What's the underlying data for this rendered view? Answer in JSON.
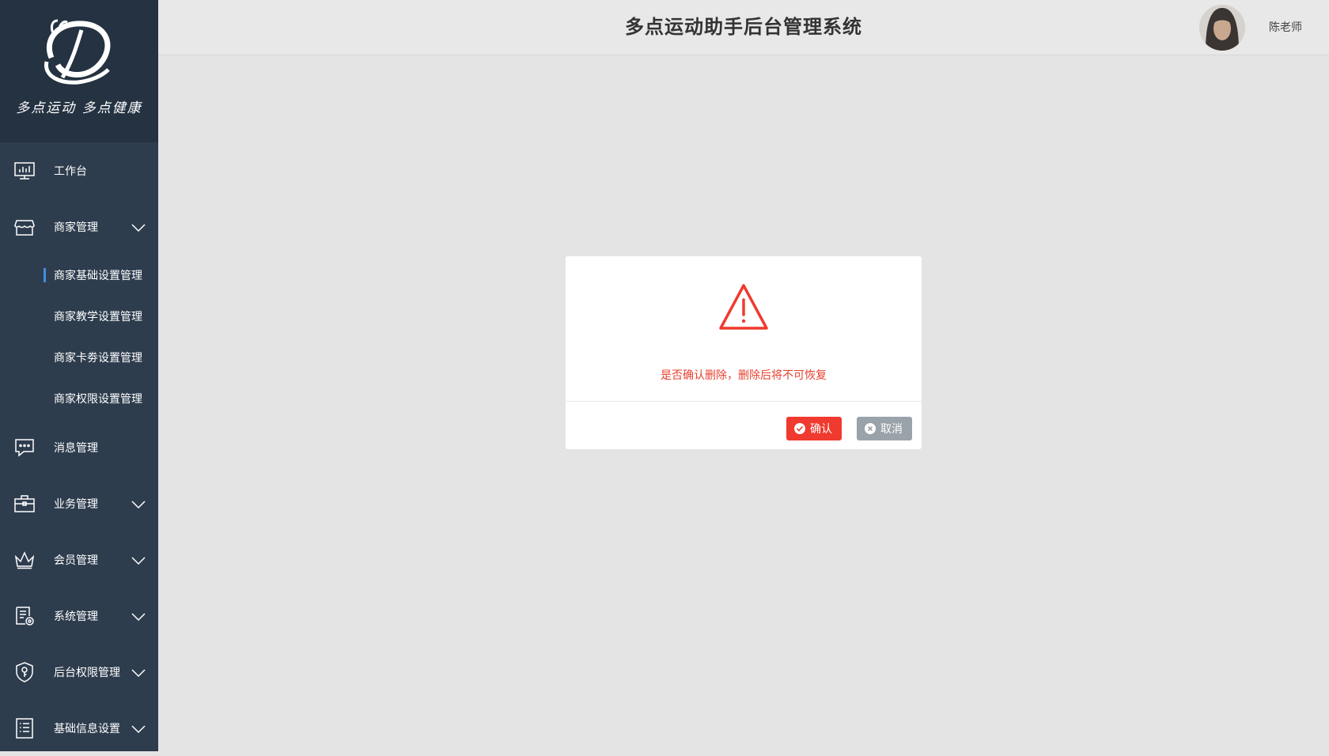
{
  "brand": {
    "slogan": "多点运动 多点健康"
  },
  "header": {
    "title": "多点运动助手后台管理系统",
    "username": "陈老师"
  },
  "sidebar": {
    "items": [
      {
        "label": "工作台",
        "icon": "monitor-chart-icon",
        "expandable": false
      },
      {
        "label": "商家管理",
        "icon": "store-icon",
        "expandable": true,
        "expanded": true,
        "children": [
          {
            "label": "商家基础设置管理",
            "active": true
          },
          {
            "label": "商家教学设置管理",
            "active": false
          },
          {
            "label": "商家卡劵设置管理",
            "active": false
          },
          {
            "label": "商家权限设置管理",
            "active": false
          }
        ]
      },
      {
        "label": "消息管理",
        "icon": "chat-bubble-icon",
        "expandable": false
      },
      {
        "label": "业务管理",
        "icon": "briefcase-icon",
        "expandable": true
      },
      {
        "label": "会员管理",
        "icon": "crown-icon",
        "expandable": true
      },
      {
        "label": "系统管理",
        "icon": "settings-document-icon",
        "expandable": true
      },
      {
        "label": "后台权限管理",
        "icon": "shield-key-icon",
        "expandable": true
      },
      {
        "label": "基础信息设置",
        "icon": "list-document-icon",
        "expandable": true
      }
    ]
  },
  "dialog": {
    "icon": "warning-triangle-icon",
    "message": "是否确认删除，删除后将不可恢复",
    "confirm_label": "确认",
    "cancel_label": "取消"
  },
  "colors": {
    "sidebar_bg": "#2e3d4e",
    "brand_bg": "#243241",
    "active_indicator": "#3d8fe0",
    "danger": "#f03a2f",
    "cancel": "#9aa3a9"
  }
}
